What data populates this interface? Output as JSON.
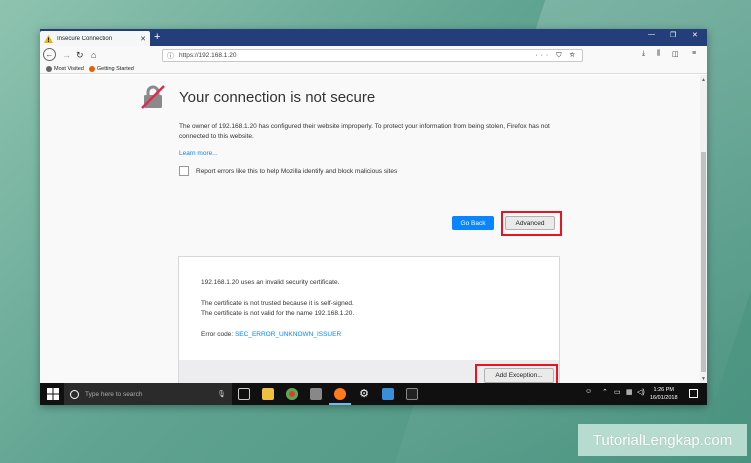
{
  "browser": {
    "tab_title": "Insecure Connection",
    "tab_close": "✕",
    "new_tab": "+",
    "url": "https://192.168.1.20",
    "url_actions": "··· ⛉ ☆",
    "bookmarks": [
      {
        "label": "Most Visited",
        "icon": "gear-icon"
      },
      {
        "label": "Getting Started",
        "icon": "firefox-icon"
      }
    ]
  },
  "page": {
    "title": "Your connection is not secure",
    "description": "The owner of 192.168.1.20 has configured their website improperly. To protect your information from being stolen, Firefox has not connected to this website.",
    "learn_more": "Learn more...",
    "report_label": "Report errors like this to help Mozilla identify and block malicious sites",
    "go_back": "Go Back",
    "advanced": "Advanced",
    "advanced_panel": {
      "line1": "192.168.1.20 uses an invalid security certificate.",
      "line2": "The certificate is not trusted because it is self-signed.",
      "line3": "The certificate is not valid for the name 192.168.1.20.",
      "error_code_label": "Error code:",
      "error_code": "SEC_ERROR_UNKNOWN_ISSUER",
      "add_exception": "Add Exception..."
    }
  },
  "taskbar": {
    "search_placeholder": "Type here to search",
    "time": "1:26 PM",
    "date": "16/01/2018"
  },
  "watermark": "TutorialLengkap.com",
  "colors": {
    "accent": "#0a84ff",
    "highlight": "#e8141f",
    "titlebar": "#243e7a"
  }
}
